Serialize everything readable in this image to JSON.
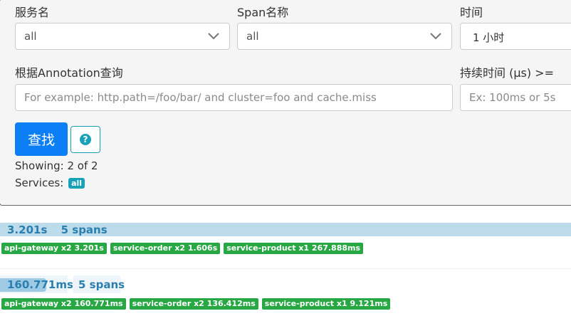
{
  "search": {
    "service_label": "服务名",
    "service_value": "all",
    "span_label": "Span名称",
    "span_value": "all",
    "time_label": "时间",
    "time_value": "1 小时",
    "annotation_label": "根据Annotation查询",
    "annotation_placeholder": "For example: http.path=/foo/bar/ and cluster=foo and cache.miss",
    "duration_label": "持续时间 (μs) >=",
    "duration_placeholder": "Ex: 100ms or 5s",
    "search_button": "查找",
    "help_icon": "question-circle-icon"
  },
  "results": {
    "showing": "Showing: 2 of 2",
    "services_label": "Services:",
    "services_badge": "all"
  },
  "traces": [
    {
      "duration": "3.201s",
      "spans": "5 spans",
      "services": [
        "api-gateway x2 3.201s",
        "service-order x2 1.606s",
        "service-product x1 267.888ms"
      ]
    },
    {
      "duration": "160.771ms",
      "spans": "5 spans",
      "duration_fraction": 0.05,
      "services": [
        "api-gateway x2 160.771ms",
        "service-order x2 136.412ms",
        "service-product x1 9.121ms"
      ]
    }
  ],
  "colors": {
    "primary": "#0d7ff6",
    "info": "#17a2b8",
    "success": "#28a745",
    "trace_bar": "#bcdcec"
  }
}
